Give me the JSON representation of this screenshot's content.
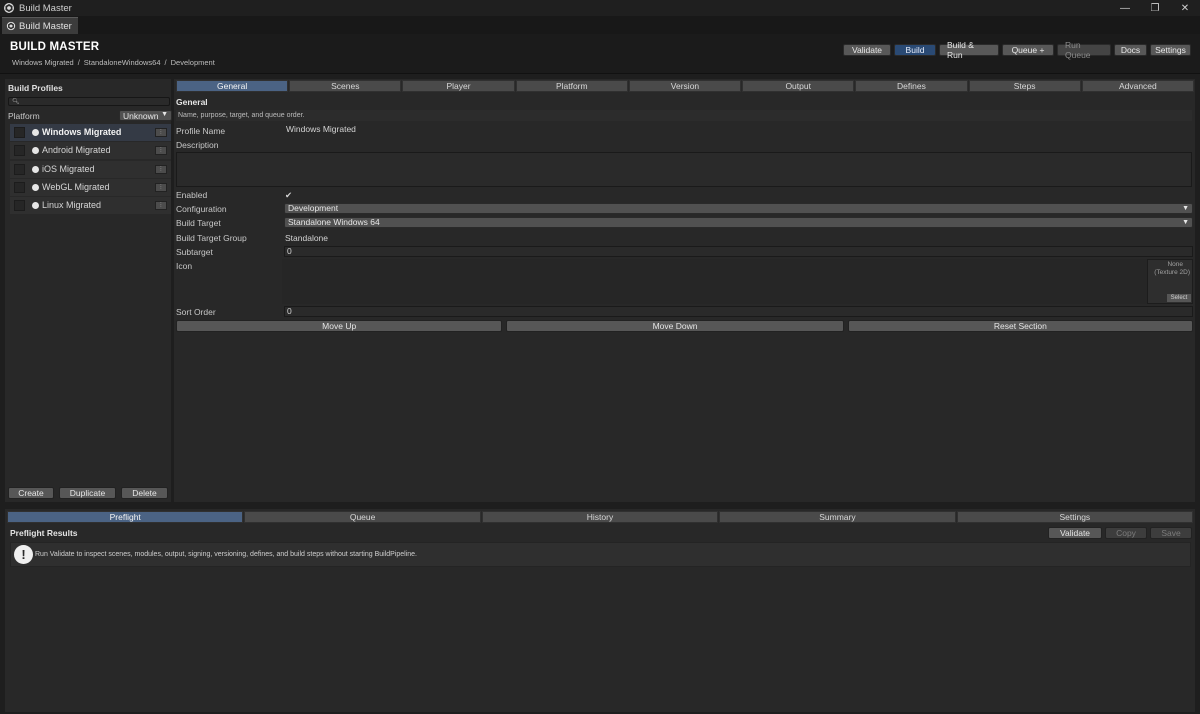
{
  "window": {
    "title": "Build Master",
    "tab_label": "Build Master"
  },
  "header": {
    "title": "BUILD MASTER",
    "breadcrumb": [
      "Windows Migrated",
      "StandaloneWindows64",
      "Development"
    ],
    "breadcrumb_sep": "/",
    "buttons": {
      "validate": "Validate",
      "build": "Build",
      "build_run": "Build & Run",
      "queue_add": "Queue +",
      "run_queue": "Run Queue",
      "docs": "Docs",
      "settings": "Settings"
    }
  },
  "sidebar": {
    "title": "Build Profiles",
    "search_placeholder": "",
    "platform_label": "Platform",
    "platform_value": "Unknown",
    "profiles": [
      {
        "name": "Windows Migrated",
        "selected": true
      },
      {
        "name": "Android Migrated",
        "selected": false
      },
      {
        "name": "iOS Migrated",
        "selected": false
      },
      {
        "name": "WebGL Migrated",
        "selected": false
      },
      {
        "name": "Linux Migrated",
        "selected": false
      }
    ],
    "buttons": {
      "create": "Create",
      "duplicate": "Duplicate",
      "delete": "Delete"
    }
  },
  "main": {
    "tabs": [
      "General",
      "Scenes",
      "Player",
      "Platform",
      "Version",
      "Output",
      "Defines",
      "Steps",
      "Advanced"
    ],
    "active_tab": "General",
    "section_title": "General",
    "section_desc": "Name, purpose, target, and queue order.",
    "fields": {
      "profile_name_label": "Profile Name",
      "profile_name_value": "Windows Migrated",
      "description_label": "Description",
      "enabled_label": "Enabled",
      "enabled_value": "✔",
      "configuration_label": "Configuration",
      "configuration_value": "Development",
      "build_target_label": "Build Target",
      "build_target_value": "Standalone Windows 64",
      "build_target_group_label": "Build Target Group",
      "build_target_group_value": "Standalone",
      "subtarget_label": "Subtarget",
      "subtarget_value": "0",
      "icon_label": "Icon",
      "icon_none": "None",
      "icon_type": "(Texture 2D)",
      "icon_select": "Select",
      "sort_order_label": "Sort Order",
      "sort_order_value": "0"
    },
    "actions": {
      "move_up": "Move Up",
      "move_down": "Move Down",
      "reset_section": "Reset Section"
    }
  },
  "bottom": {
    "tabs": [
      "Preflight",
      "Queue",
      "History",
      "Summary",
      "Settings"
    ],
    "active_tab": "Preflight",
    "title": "Preflight Results",
    "buttons": {
      "validate": "Validate",
      "copy": "Copy",
      "save": "Save"
    },
    "message_icon": "!",
    "message": "Run Validate to inspect scenes, modules, output, signing, versioning, defines, and build steps without starting BuildPipeline."
  }
}
